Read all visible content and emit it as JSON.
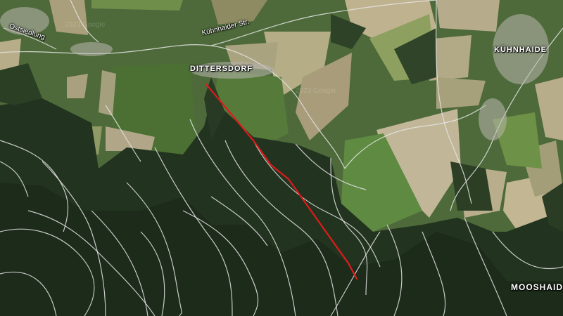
{
  "map": {
    "view": "satellite",
    "labels": {
      "ostsiedlung": "Ostsiedlung",
      "kuhnhaider_str": "Kühnhaider Str.",
      "dittersdorf": "DITTERSDORF",
      "kuhnhaide": "KÜHNHAIDE",
      "mooshaide": "MOOSHAIDE"
    },
    "watermark": "2023 Google",
    "route_color": "#e01b1b",
    "forest_color": "#22331f",
    "field_color": "#a9a77a",
    "road_color": "#e6e6e6"
  }
}
